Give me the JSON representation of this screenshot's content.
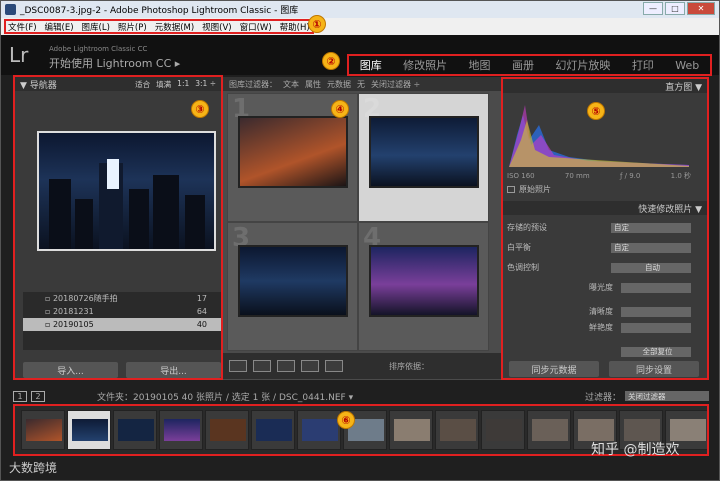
{
  "title": "_DSC0087-3.jpg-2 - Adobe Photoshop Lightroom Classic - 图库",
  "window_buttons": [
    "—",
    "□",
    "✕"
  ],
  "menu": [
    "文件(F)",
    "编辑(E)",
    "图库(L)",
    "照片(P)",
    "元数据(M)",
    "视图(V)",
    "窗口(W)",
    "帮助(H)"
  ],
  "brand": {
    "logo": "Lr",
    "line1": "Adobe Lightroom Classic CC",
    "line2": "开始使用 Lightroom CC ▸"
  },
  "modules": [
    "图库",
    "修改照片",
    "地图",
    "画册",
    "幻灯片放映",
    "打印",
    "Web"
  ],
  "badges": [
    "①",
    "②",
    "③",
    "④",
    "⑤",
    "⑥"
  ],
  "navigator": {
    "title": "▼ 导航器",
    "zoom": [
      "适合",
      "填满",
      "1:1",
      "3:1 ÷"
    ]
  },
  "folders": [
    {
      "name": "20180726随手拍",
      "count": "17"
    },
    {
      "name": "20181231",
      "count": "64"
    },
    {
      "name": "20190105",
      "count": "40"
    }
  ],
  "left_buttons": {
    "import": "导入...",
    "export": "导出..."
  },
  "filter": {
    "label": "图库过滤器：",
    "items": [
      "文本",
      "属性",
      "元数据",
      "无"
    ],
    "preset": "关闭过滤器 ÷"
  },
  "grid_numbers": [
    "1",
    "2",
    "3",
    "4"
  ],
  "toolbar": {
    "sort": "排序依据："
  },
  "histogram": {
    "title": "直方图 ▼",
    "iso": "ISO 160",
    "focal": "70 mm",
    "aperture": "ƒ / 9.0",
    "shutter": "1.0 秒",
    "original": "原始照片"
  },
  "quick": {
    "title": "快速修改照片 ▼",
    "preset_label": "存储的预设",
    "preset_value": "自定",
    "wb_label": "白平衡",
    "wb_value": "自定",
    "tone_label": "色调控制",
    "auto": "自动",
    "exposure": "曝光度",
    "clarity": "清晰度",
    "vibrance": "鲜艳度",
    "reset": "全部复位"
  },
  "right_buttons": {
    "sync_meta": "同步元数据",
    "sync_settings": "同步设置"
  },
  "infobar": {
    "pages": [
      "1",
      "2"
    ],
    "path": "文件夹：20190105   40 张照片 / 选定 1 张 / DSC_0441.NEF ▾",
    "filter_label": "过滤器：",
    "filter_value": "关闭过滤器"
  },
  "watermark_left": "大数跨境",
  "watermark_right": "知乎 @制造欢",
  "colors": {
    "accent_red": "#e02020",
    "badge": "#f6b417"
  }
}
